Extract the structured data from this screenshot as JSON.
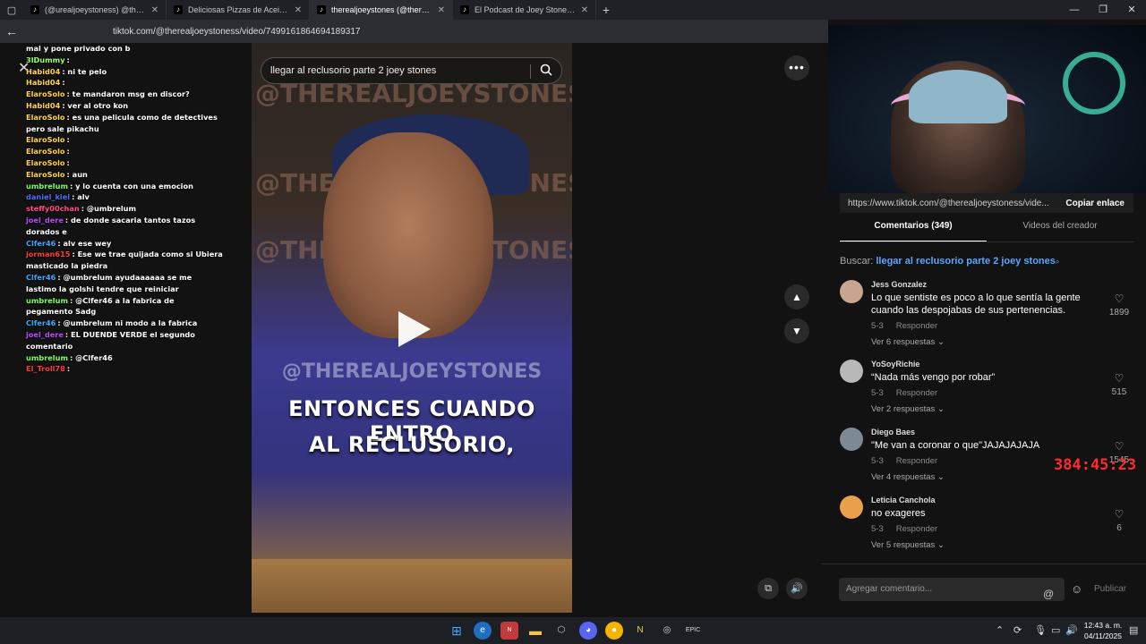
{
  "browser": {
    "tabs": [
      {
        "label": "(@urealjoeystoness) @therealjoe",
        "icon": "tiktok-icon"
      },
      {
        "label": "Deliciosas Pizzas de Aceite en la",
        "icon": "tiktok-icon"
      },
      {
        "label": "therealjoeystones (@therealjoey",
        "icon": "tiktok-icon"
      },
      {
        "label": "El Podcast de Joey Stones: Entrev",
        "icon": "tiktok-icon"
      }
    ],
    "url": "tiktok.com/@therealjoeystoness/video/7499161864694189317"
  },
  "video": {
    "search_text": "llegar al reclusorio parte 2 joey stones",
    "watermark": "@THEREALJOEYSTONES",
    "subtitle_line1": "ENTONCES CUANDO ENTRO",
    "subtitle_line2": "AL RECLUSORIO,",
    "more_label": "•••"
  },
  "chat": [
    {
      "user": "",
      "text": "mal y pone privado con b",
      "color": "#ffffff"
    },
    {
      "user": "3lDummy",
      "text": ":",
      "color": "#9aff6a"
    },
    {
      "user": "Habid04",
      "text": ": ni te pelo",
      "color": "#ffd34a"
    },
    {
      "user": "Habid04",
      "text": ":",
      "color": "#ffd34a"
    },
    {
      "user": "ElaroSolo",
      "text": ": te mandaron msg en discor?",
      "color": "#ffd34a"
    },
    {
      "user": "Habid04",
      "text": ": ver al otro kon",
      "color": "#ffd34a"
    },
    {
      "user": "ElaroSolo",
      "text": ": es una pelicula como de detectives pero sale pikachu",
      "color": "#ffd34a"
    },
    {
      "user": "ElaroSolo",
      "text": ":",
      "color": "#ffd34a"
    },
    {
      "user": "ElaroSolo",
      "text": ":",
      "color": "#ffd34a"
    },
    {
      "user": "ElaroSolo",
      "text": ":",
      "color": "#ffd34a"
    },
    {
      "user": "ElaroSolo",
      "text": ": aun",
      "color": "#ffd34a"
    },
    {
      "user": "umbrelum",
      "text": ": y lo cuenta con una emocion",
      "color": "#7dff5a"
    },
    {
      "user": "daniel_kiel",
      "text": ": alv",
      "color": "#4a6cff"
    },
    {
      "user": "steffy00chan",
      "text": ": @umbrelum",
      "color": "#ff4a8a"
    },
    {
      "user": "joel_dere",
      "text": ": de donde sacaria tantos tazos dorados e",
      "color": "#b64aff"
    },
    {
      "user": "Clfer46",
      "text": ": alv ese wey",
      "color": "#3fa6ff"
    },
    {
      "user": "jorman615",
      "text": ": Ese we trae quijada como si Ubiera masticado la piedra",
      "color": "#ff3a3a"
    },
    {
      "user": "Clfer46",
      "text": ": @umbrelum ayudaaaaaa se me lastimo la golshi tendre que reiniciar",
      "color": "#3fa6ff"
    },
    {
      "user": "umbrelum",
      "text": ": @Clfer46 a la fabrica de pegamento Sadg",
      "color": "#7dff5a"
    },
    {
      "user": "Clfer46",
      "text": ": @umbrelum ni modo a la fabrica",
      "color": "#3fa6ff"
    },
    {
      "user": "joel_dere",
      "text": ": EL DUENDE VERDE el segundo comentario",
      "color": "#b64aff"
    },
    {
      "user": "umbrelum",
      "text": ": @Clfer46",
      "color": "#7dff5a"
    },
    {
      "user": "El_Troll78",
      "text": ":",
      "color": "#ff3a3a"
    }
  ],
  "panel": {
    "copy_url": "https://www.tiktok.com/@therealjoeystoness/vide...",
    "copy_label": "Copiar enlace",
    "tab_comments": "Comentarios (349)",
    "tab_creator": "Videos del creador",
    "search_prefix": "Buscar:",
    "search_query": "llegar al reclusorio parte 2 joey stones",
    "comments": [
      {
        "name": "Jess Gonzalez",
        "text": "Lo que sentiste es poco a lo que sentía la gente cuando las despojabas de sus pertenencias.",
        "date": "5-3",
        "reply": "Responder",
        "more": "Ver 6 respuestas",
        "likes": "1899",
        "avatar_color": "#c9a48e"
      },
      {
        "name": "YoSoyRichie",
        "text": "“Nada más vengo por robar”",
        "date": "5-3",
        "reply": "Responder",
        "more": "Ver 2 respuestas",
        "likes": "515",
        "avatar_color": "#b8b8b8"
      },
      {
        "name": "Diego Baes",
        "text": "\"Me van a coronar o que\"JAJAJAJAJA",
        "date": "5-3",
        "reply": "Responder",
        "more": "Ver 4 respuestas",
        "likes": "1545",
        "avatar_color": "#7d8a96"
      },
      {
        "name": "Leticia Canchola",
        "text": "no exageres",
        "date": "5-3",
        "reply": "Responder",
        "more": "Ver 5 respuestas",
        "likes": "6",
        "avatar_color": "#e9a04a"
      }
    ],
    "add_placeholder": "Agregar comentario...",
    "publish": "Publicar"
  },
  "overlay": {
    "timer": "384:45:23"
  },
  "taskbar": {
    "time": "12:43 a. m.",
    "date": "04/11/2025"
  }
}
